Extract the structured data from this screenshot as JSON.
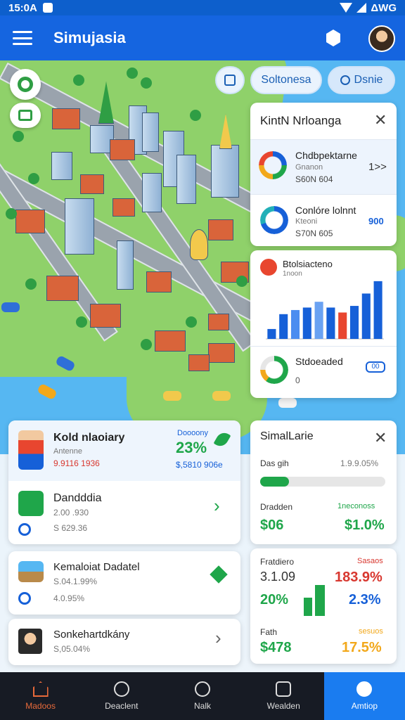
{
  "status": {
    "time": "15:0A",
    "right_text": "ΔWG"
  },
  "appbar": {
    "title": "Simujasia"
  },
  "map_chips": {
    "chip1": "Soltonesa",
    "chip2": "Dsnie"
  },
  "side_panel": {
    "title": "KintN Nrloanga",
    "items": [
      {
        "name": "Chdbpektarne",
        "sub": "Gnanon",
        "value": "S60N 604",
        "right": "1>>"
      },
      {
        "name": "Conlóre lolnnt",
        "sub": "Kteoni",
        "value": "S70N 605",
        "right": "900"
      }
    ]
  },
  "chart_panel": {
    "title": "Btolsiacteno",
    "sub": "1noon"
  },
  "chart_data": {
    "type": "bar",
    "categories": [
      "1",
      "2",
      "3",
      "4",
      "5",
      "6",
      "7",
      "8",
      "9",
      "10"
    ],
    "values": [
      12,
      30,
      35,
      38,
      45,
      38,
      32,
      40,
      55,
      70
    ],
    "colors": [
      "#1660d8",
      "#1660d8",
      "#4b8df0",
      "#1660d8",
      "#6aa2f2",
      "#1660d8",
      "#e8462f",
      "#1660d8",
      "#1660d8",
      "#1660d8"
    ],
    "title": "",
    "xlabel": "",
    "ylabel": "",
    "ylim": [
      0,
      75
    ]
  },
  "sched_panel": {
    "title": "Stdoeaded",
    "value": "0",
    "badge": "00"
  },
  "list": [
    {
      "title": "Kold nlaoiary",
      "sub": "Antenne",
      "amount": "9.9116 1936",
      "tag": "Doooony",
      "pct": "23%",
      "val": "$,5810 906e"
    },
    {
      "title": "Dandddia",
      "sub": "2.00 .930",
      "amount": "S 629.36"
    },
    {
      "title": "Kemaloiat Dadatel",
      "sub": "S.04.1.99%",
      "amount": "4.0.95%"
    },
    {
      "title": "Sonkehartdkány",
      "sub": "S,05.04%"
    }
  ],
  "sim_card": {
    "title": "SimalLarie",
    "row1_label": "Das gih",
    "row1_value": "1.9.9.05%",
    "progress": 0.23,
    "row2_label": "Dradden",
    "row2_right": "1neconoss",
    "val_left": "$06",
    "val_right": "$1.0%"
  },
  "stats_card": {
    "label1": "Fratdiero",
    "label1_right": "Sasaos",
    "v1": "3.1.09",
    "v1_right": "183.9%",
    "v2": "20%",
    "v2_right": "2.3%",
    "label3": "Fath",
    "label3_right": "sesuos",
    "v3": "$478",
    "v3_right": "17.5%"
  },
  "nav": [
    {
      "label": "Madoos"
    },
    {
      "label": "Deaclent"
    },
    {
      "label": "Nalk"
    },
    {
      "label": "Wealden"
    },
    {
      "label": "Amtiop"
    }
  ]
}
